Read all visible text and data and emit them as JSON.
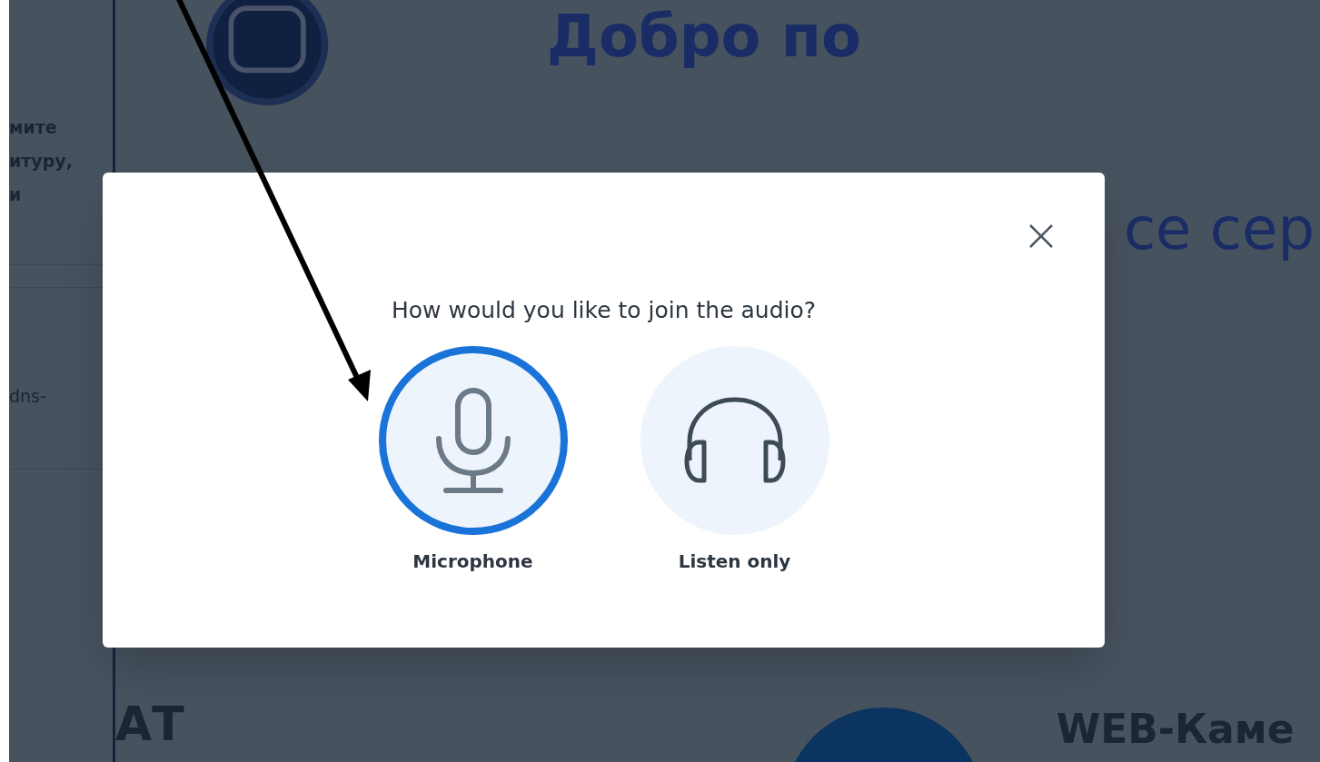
{
  "background": {
    "sidebar_texts": [
      "мите",
      "итуру,",
      "и"
    ],
    "sidebar_link": "dns-",
    "heading": "Добро по",
    "subheading": "се сер",
    "section_title": "АТ",
    "webcam_title": "WEB-Каме"
  },
  "dialog": {
    "question": "How would you like to join the audio?",
    "options": [
      {
        "kind": "microphone",
        "label": "Microphone",
        "selected": true
      },
      {
        "kind": "headphones",
        "label": "Listen only",
        "selected": false
      }
    ]
  }
}
